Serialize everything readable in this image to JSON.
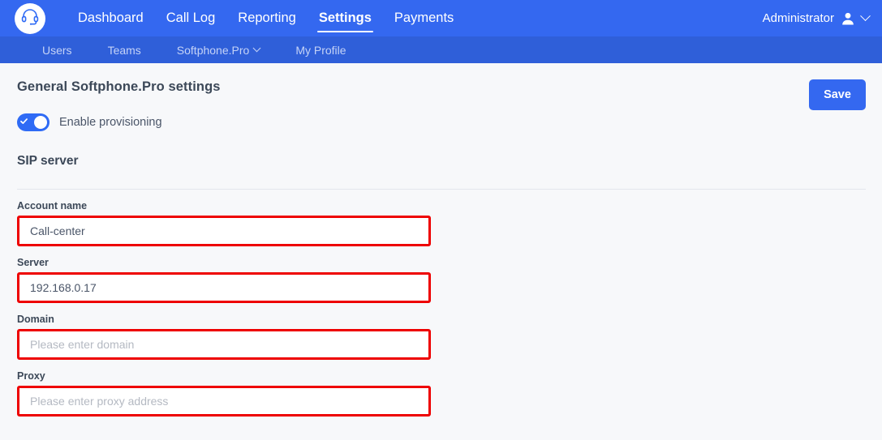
{
  "header": {
    "logo_icon": "headset-icon",
    "nav": [
      {
        "label": "Dashboard",
        "active": false
      },
      {
        "label": "Call Log",
        "active": false
      },
      {
        "label": "Reporting",
        "active": false
      },
      {
        "label": "Settings",
        "active": true
      },
      {
        "label": "Payments",
        "active": false
      }
    ],
    "account": {
      "label": "Administrator",
      "avatar_icon": "person-icon",
      "chevron_icon": "chevron-down-icon"
    },
    "background_color": "#3468f0"
  },
  "subnav": {
    "background_color": "#2f5fd9",
    "items": [
      {
        "label": "Users",
        "has_chevron": false
      },
      {
        "label": "Teams",
        "has_chevron": false
      },
      {
        "label": "Softphone.Pro",
        "has_chevron": true
      },
      {
        "label": "My Profile",
        "has_chevron": false
      }
    ]
  },
  "main": {
    "page_title": "General Softphone.Pro settings",
    "save_label": "Save",
    "save_color": "#3468f0",
    "provisioning": {
      "label": "Enable provisioning",
      "enabled": true,
      "on_color": "#2f6bf5"
    },
    "section_title": "SIP server",
    "highlight_color": "#ee0000",
    "fields": [
      {
        "label": "Account name",
        "value": "Call-center",
        "placeholder": "",
        "highlighted": true
      },
      {
        "label": "Server",
        "value": "192.168.0.17",
        "placeholder": "",
        "highlighted": true
      },
      {
        "label": "Domain",
        "value": "",
        "placeholder": "Please enter domain",
        "highlighted": true
      },
      {
        "label": "Proxy",
        "value": "",
        "placeholder": "Please enter proxy address",
        "highlighted": true
      }
    ]
  }
}
